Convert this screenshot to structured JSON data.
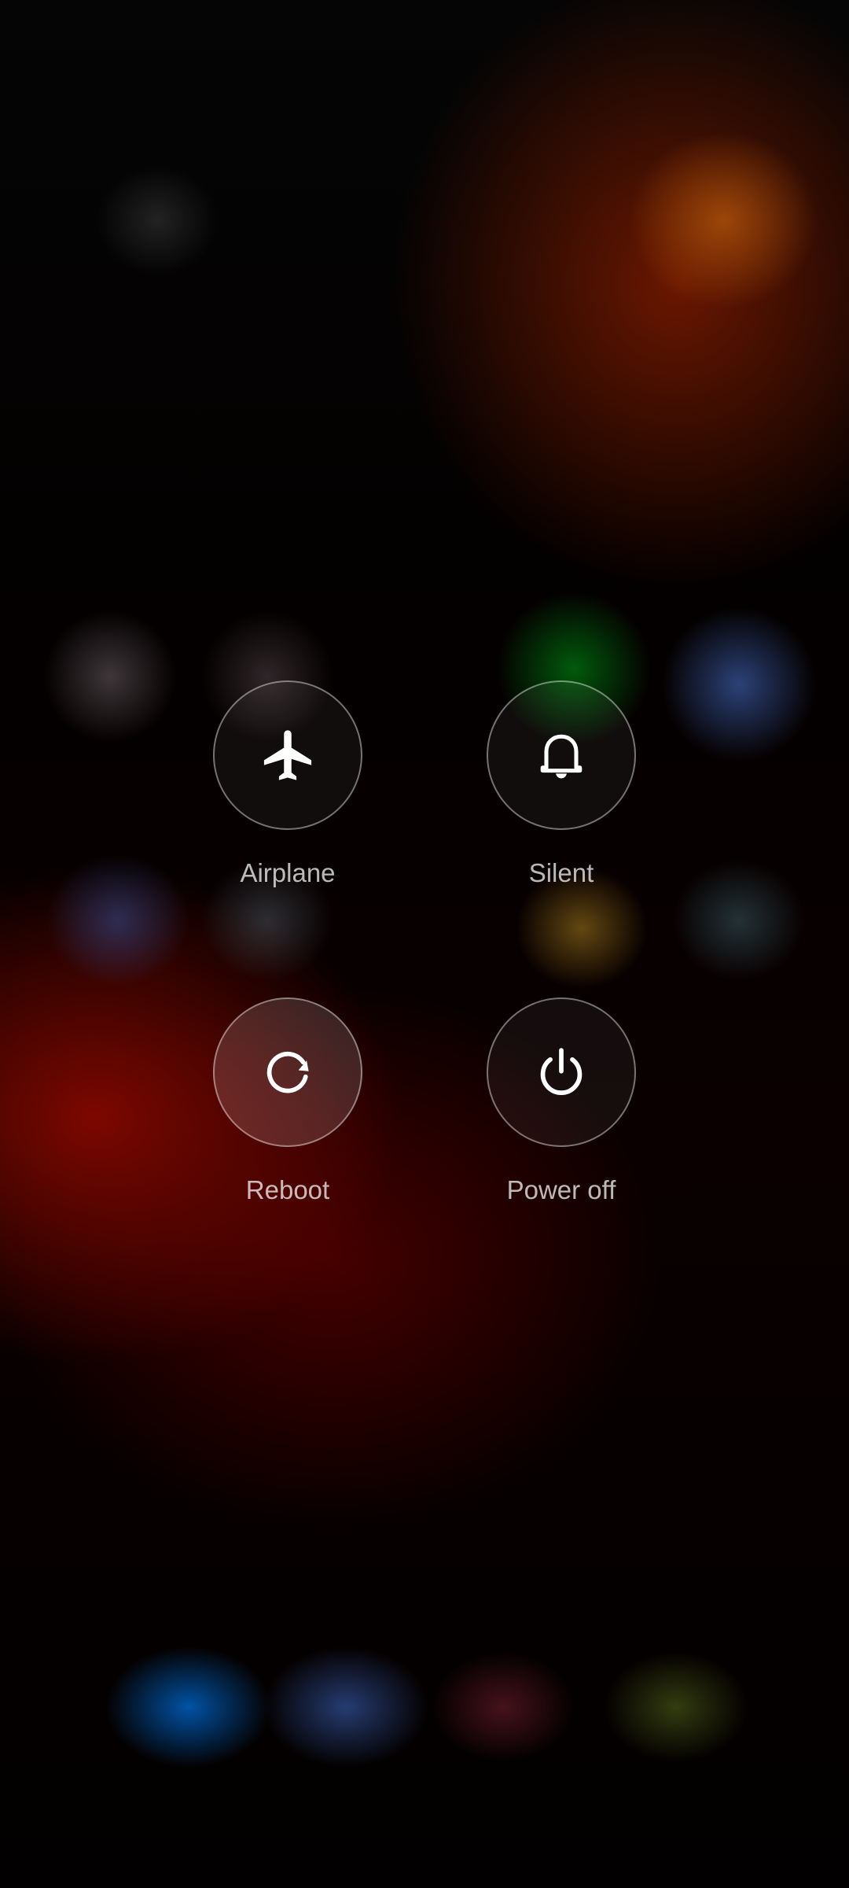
{
  "power_menu": {
    "actions": [
      {
        "label": "Airplane",
        "icon": "airplane-icon"
      },
      {
        "label": "Silent",
        "icon": "bell-icon"
      },
      {
        "label": "Reboot",
        "icon": "reboot-icon"
      },
      {
        "label": "Power off",
        "icon": "power-icon"
      }
    ]
  },
  "colors": {
    "icon": "#ffffff",
    "label": "#b8b8b8",
    "circle_border": "#8a8a8a"
  }
}
